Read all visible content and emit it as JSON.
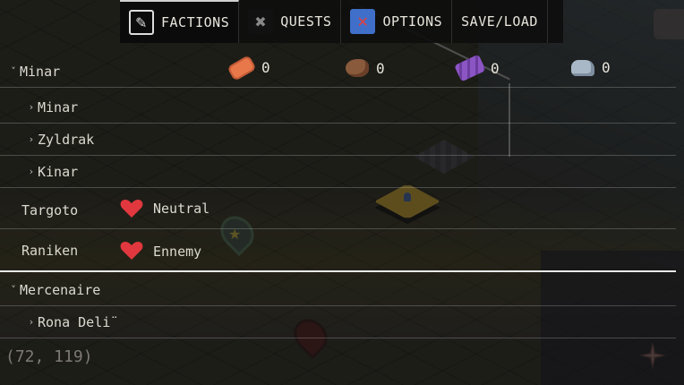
{
  "tabs": [
    {
      "label": "FACTIONS",
      "icon": "edit-icon",
      "active": true
    },
    {
      "label": "QUESTS",
      "icon": "scroll-icon",
      "active": false
    },
    {
      "label": "OPTIONS",
      "icon": "settings-icon",
      "active": false
    },
    {
      "label": "SAVE/LOAD",
      "icon": null,
      "active": false
    }
  ],
  "resources": [
    {
      "name": "gem-orange",
      "value": "0"
    },
    {
      "name": "meat",
      "value": "0"
    },
    {
      "name": "logs",
      "value": "0"
    },
    {
      "name": "ore",
      "value": "0"
    }
  ],
  "factions": {
    "minar_group": "Minar",
    "minar_sub": [
      "Minar",
      "Zyldrak",
      "Kinar"
    ],
    "targoto": {
      "name": "Targoto",
      "status": "Neutral"
    },
    "raniken": {
      "name": "Raniken",
      "status": "Ennemy"
    },
    "mercenaire_group": "Mercenaire",
    "mercenaire_sub": [
      "Rona Deli¨"
    ]
  },
  "coords": "(72, 119)",
  "colors": {
    "heart": "#e0383e",
    "accent_line": "#e8e8e8"
  }
}
